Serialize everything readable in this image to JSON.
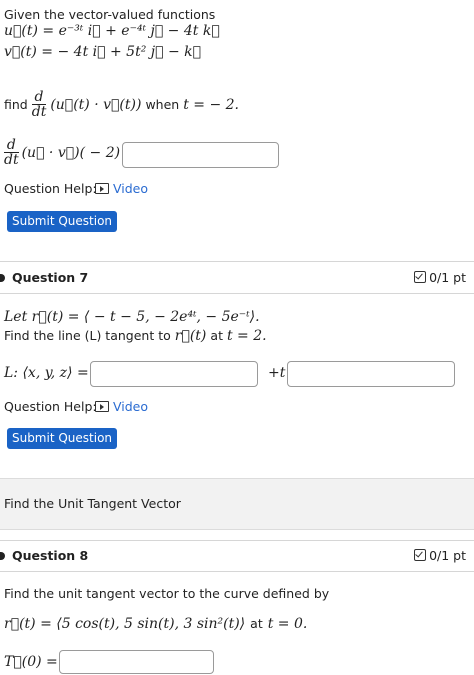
{
  "q6": {
    "intro": "Given the vector-valued functions",
    "u_def": "u⃗(t) = e⁻³ᵗ i⃗ + e⁻⁴ᵗ j⃗ − 4t k⃗",
    "v_def": "v⃗(t) = − 4t i⃗ + 5t² j⃗ − k⃗",
    "find_label": "find",
    "find_expr": "(u⃗(t) · v⃗(t))",
    "when_label": "when",
    "when_expr": "t = − 2.",
    "answer_lhs": "(u⃗ · v⃗)( − 2) =",
    "frac_num": "d",
    "frac_den": "dt",
    "help_label": "Question Help:",
    "video_label": "Video",
    "submit_label": "Submit Question"
  },
  "q7": {
    "title": "Question 7",
    "score": "0/1 pt",
    "line1": "Let r⃗(t) = ⟨ − t − 5, − 2e⁴ᵗ, − 5e⁻ᵗ⟩.",
    "line2_pre": "Find the line (L) tangent to",
    "line2_mid": "r⃗(t)",
    "line2_at": "at",
    "line2_t": "t = 2.",
    "answer_lhs": "L: ⟨x, y, z⟩ =",
    "plus_t": "+t",
    "help_label": "Question Help:",
    "video_label": "Video",
    "submit_label": "Submit Question"
  },
  "section_banner": "Find the Unit Tangent Vector",
  "q8": {
    "title": "Question 8",
    "score": "0/1 pt",
    "line1": "Find the unit tangent vector to the curve defined by",
    "line2": "r⃗(t) = ⟨5 cos(t), 5 sin(t), 3 sin²(t)⟩",
    "line2_at": "at",
    "line2_t": "t = 0.",
    "answer_lhs": "T⃗(0) ="
  }
}
